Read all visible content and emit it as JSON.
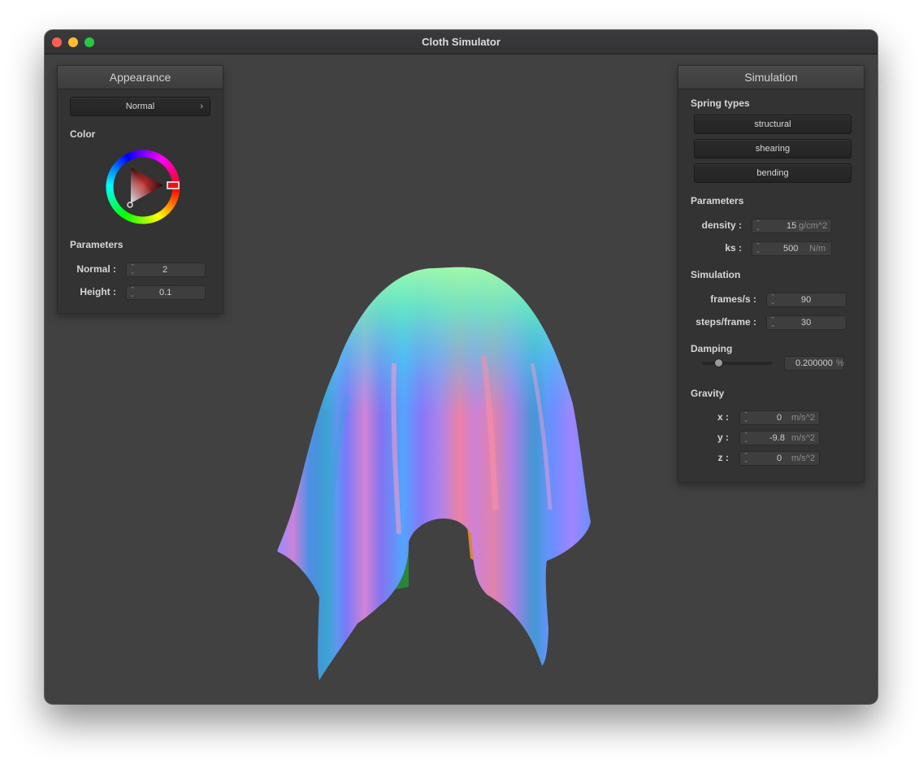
{
  "window": {
    "title": "Cloth Simulator"
  },
  "appearance": {
    "header": "Appearance",
    "shader_select": {
      "value": "Normal",
      "chevron": "›"
    },
    "color_label": "Color",
    "color_wheel": {
      "selected_hue": "#ff0000"
    },
    "parameters_label": "Parameters",
    "normal": {
      "label": "Normal :",
      "value": "2"
    },
    "height": {
      "label": "Height :",
      "value": "0.1"
    }
  },
  "simulation_panel": {
    "header": "Simulation",
    "spring_types_label": "Spring types",
    "springs": [
      "structural",
      "shearing",
      "bending"
    ],
    "parameters_label": "Parameters",
    "density": {
      "label": "density :",
      "value": "15",
      "unit": "g/cm^2"
    },
    "ks": {
      "label": "ks :",
      "value": "500",
      "unit": "N/m"
    },
    "simulation_label": "Simulation",
    "fps": {
      "label": "frames/s :",
      "value": "90"
    },
    "steps": {
      "label": "steps/frame :",
      "value": "30"
    },
    "damping_label": "Damping",
    "damping": {
      "value": "0.200000",
      "unit": "%",
      "slider_fraction": 0.2
    },
    "gravity_label": "Gravity",
    "gravity": {
      "x": {
        "label": "x :",
        "value": "0",
        "unit": "m/s^2"
      },
      "y": {
        "label": "y :",
        "value": "-9.8",
        "unit": "m/s^2"
      },
      "z": {
        "label": "z :",
        "value": "0",
        "unit": "m/s^2"
      }
    }
  }
}
